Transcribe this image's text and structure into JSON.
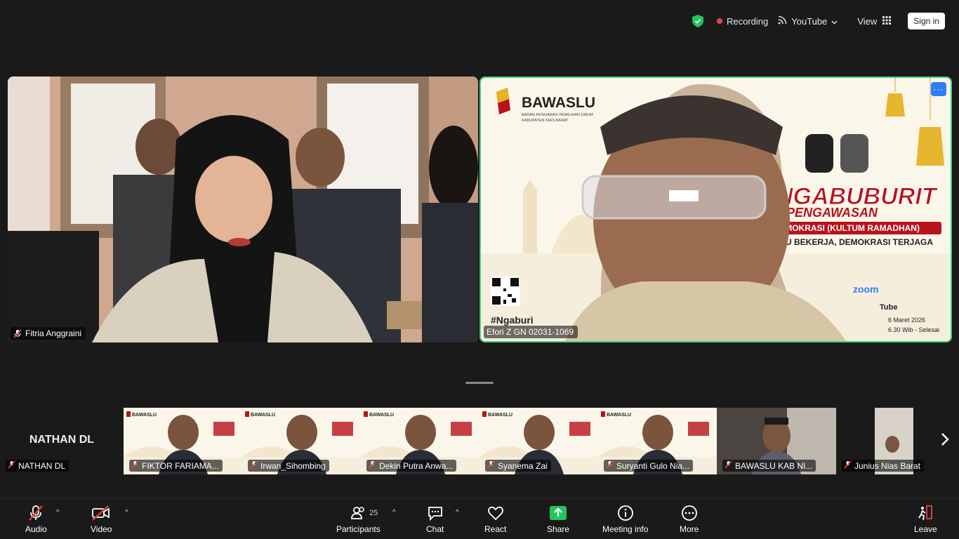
{
  "topbar": {
    "recording_label": "Recording",
    "youtube_label": "YouTube",
    "view_label": "View",
    "signin_label": "Sign in"
  },
  "main": {
    "left_participant": "Fitria Anggraini",
    "right_participant": "Efori Z GN 02031-1069",
    "banner": {
      "org": "BAWASLU",
      "org_sub1": "BADAN PENGAWAS PEMILIHAN UMUM",
      "org_sub2": "KABUPATEN NIAS BARAT",
      "title1": "NGABUBURIT",
      "title2": "PENGAWASAN",
      "sub1": "A DEMOKRASI (KULTUM RAMADHAN)",
      "sub2": "ASLU BEKERJA, DEMOKRASI TERJAGA",
      "hashtag": "#Ngaburi",
      "zoom": "zoom",
      "tube": "Tube",
      "date": "6 Maret 2026",
      "time": "6.30 Wib - Selesai"
    }
  },
  "thumbnails": [
    {
      "name": "NATHAN DL",
      "big": "NATHAN DL"
    },
    {
      "name": "FIKTOR FARIAMA..."
    },
    {
      "name": "Irwan_Sihombing"
    },
    {
      "name": "Dekin Putra Anwa..."
    },
    {
      "name": "Syanema Zai"
    },
    {
      "name": "Suryanti Gulo Nia..."
    },
    {
      "name": "BAWASLU KAB NI..."
    },
    {
      "name": "Junius Nias Barat"
    }
  ],
  "thumb_banner_org": "BAWASLU",
  "toolbar": {
    "audio": "Audio",
    "video": "Video",
    "participants": "Participants",
    "participants_count": "25",
    "chat": "Chat",
    "react": "React",
    "share": "Share",
    "meeting_info": "Meeting info",
    "more": "More",
    "leave": "Leave"
  },
  "colors": {
    "active_speaker_border": "#3fd37f",
    "share_green": "#22c55e",
    "recording_dot": "#e64545",
    "bawaslu_red": "#b8121b"
  }
}
